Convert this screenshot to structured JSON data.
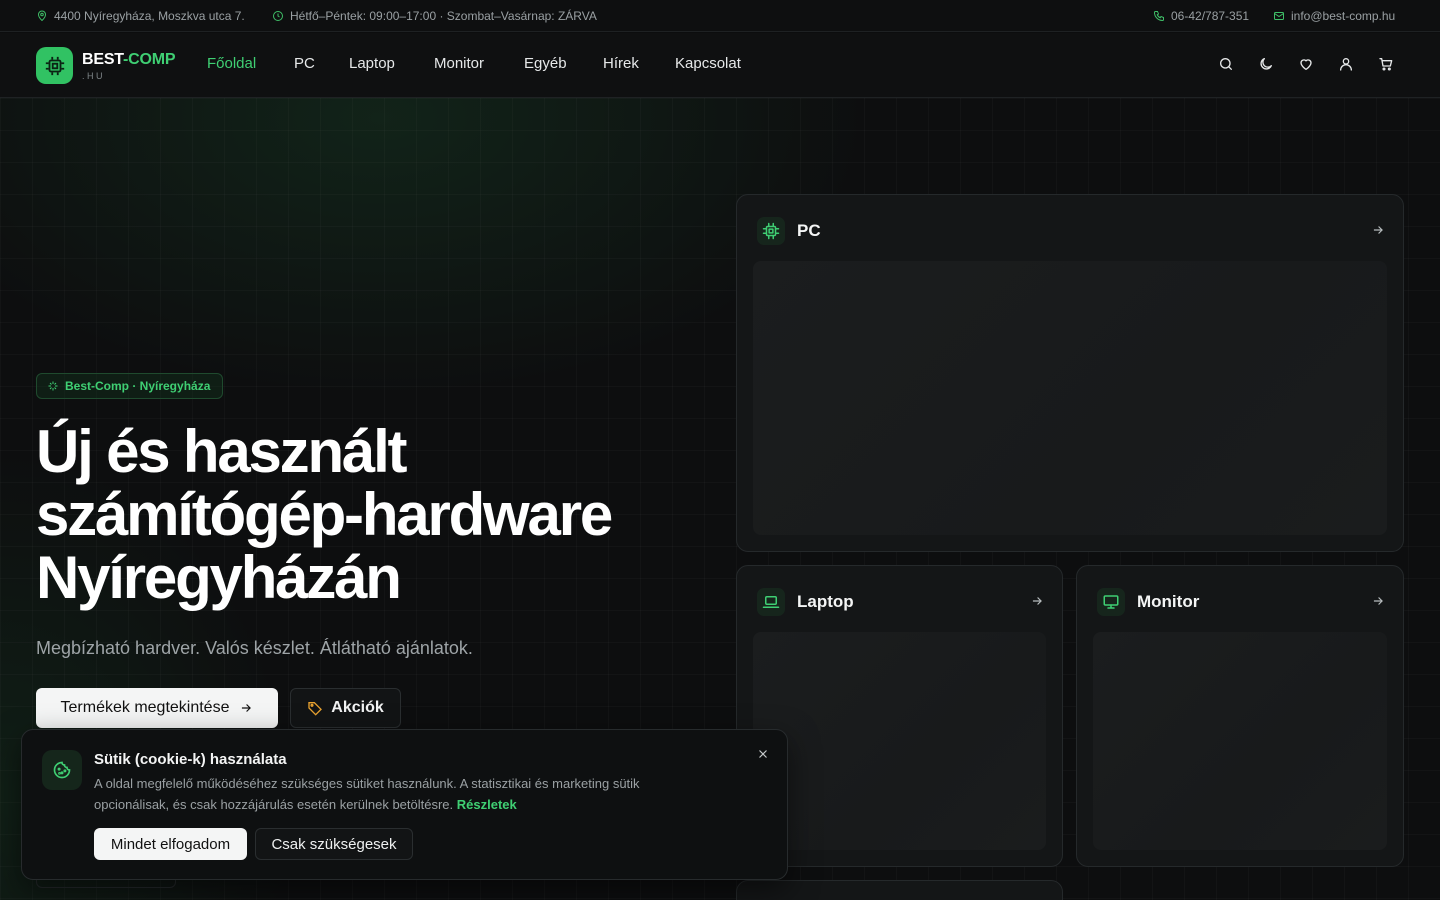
{
  "topbar": {
    "address": "4400 Nyíregyháza, Moszkva utca 7.",
    "hours": "Hétfő–Péntek: 09:00–17:00 · Szombat–Vasárnap: ZÁRVA",
    "phone": "06-42/787-351",
    "email": "info@best-comp.hu"
  },
  "logo": {
    "part1": "BEST",
    "part2": "-COMP",
    "sub": ".HU"
  },
  "nav": {
    "items": [
      "Főoldal",
      "PC",
      "Laptop",
      "Monitor",
      "Egyéb",
      "Hírek",
      "Kapcsolat"
    ],
    "active": "Főoldal",
    "icons": [
      "search-icon",
      "moon-icon",
      "heart-icon",
      "user-icon",
      "cart-icon"
    ]
  },
  "hero": {
    "badge": "Best-Comp · Nyíregyháza",
    "title": "Új és használt számítógép-hardware Nyíregyházán",
    "subtitle": "Megbízható hardver. Valós készlet. Átlátható ajánlatok.",
    "primary_button": "Termékek megtekintése",
    "secondary_button": "Akciók"
  },
  "categories": [
    {
      "title": "PC",
      "icon": "cpu-icon"
    },
    {
      "title": "Laptop",
      "icon": "laptop-icon"
    },
    {
      "title": "Monitor",
      "icon": "monitor-icon"
    }
  ],
  "cookie": {
    "title": "Sütik (cookie-k) használata",
    "text": "A oldal megfelelő működéséhez szükséges sütiket használunk. A statisztikai és marketing sütik opcionálisak, és csak hozzájárulás esetén kerülnek betöltésre.",
    "link": "Részletek",
    "accept": "Mindet elfogadom",
    "necessary": "Csak szükségesek"
  },
  "colors": {
    "accent": "#3fcf73",
    "background": "#0d0e0f",
    "card": "#141617",
    "warning": "#e8a230"
  }
}
